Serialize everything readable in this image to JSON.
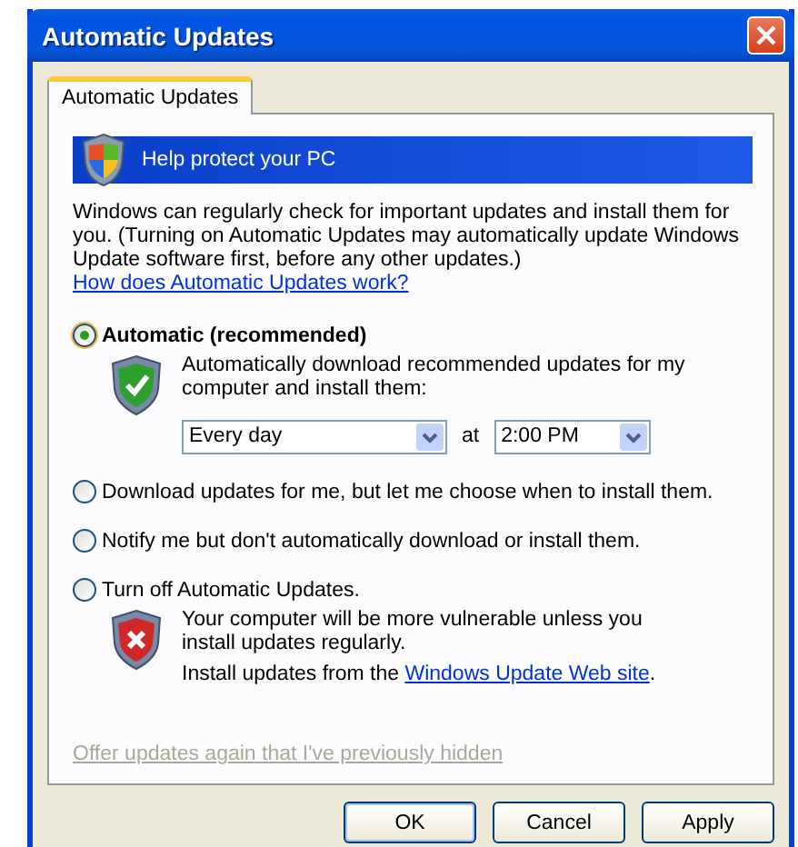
{
  "window": {
    "title": "Automatic Updates"
  },
  "tabs": [
    {
      "label": "Automatic Updates",
      "selected": true
    }
  ],
  "banner": {
    "text": "Help protect your PC"
  },
  "intro": "Windows can regularly check for important updates and install them for you. (Turning on Automatic Updates may automatically update Windows Update software first, before any other updates.)",
  "help_link": "How does Automatic Updates work?",
  "options": [
    {
      "label": "Automatic (recommended)",
      "selected": true,
      "details": {
        "kind": "schedule",
        "text": "Automatically download recommended updates for my computer and install them:",
        "day": "Every day",
        "at": "at",
        "time": "2:00 PM"
      }
    },
    {
      "label": "Download updates for me, but let me choose when to install them.",
      "selected": false
    },
    {
      "label": "Notify me but don't automatically download or install them.",
      "selected": false
    },
    {
      "label": "Turn off Automatic Updates.",
      "selected": false,
      "details": {
        "kind": "warning",
        "text": "Your computer will be more vulnerable unless you install updates regularly.",
        "before": "Install updates from the ",
        "link": "Windows Update Web site",
        "after": "."
      }
    }
  ],
  "hidden_link": {
    "text": "Offer updates again that I've previously hidden",
    "disabled": true
  },
  "buttons": [
    {
      "label": "OK",
      "default": true
    },
    {
      "label": "Cancel",
      "default": false
    },
    {
      "label": "Apply",
      "default": false
    }
  ]
}
